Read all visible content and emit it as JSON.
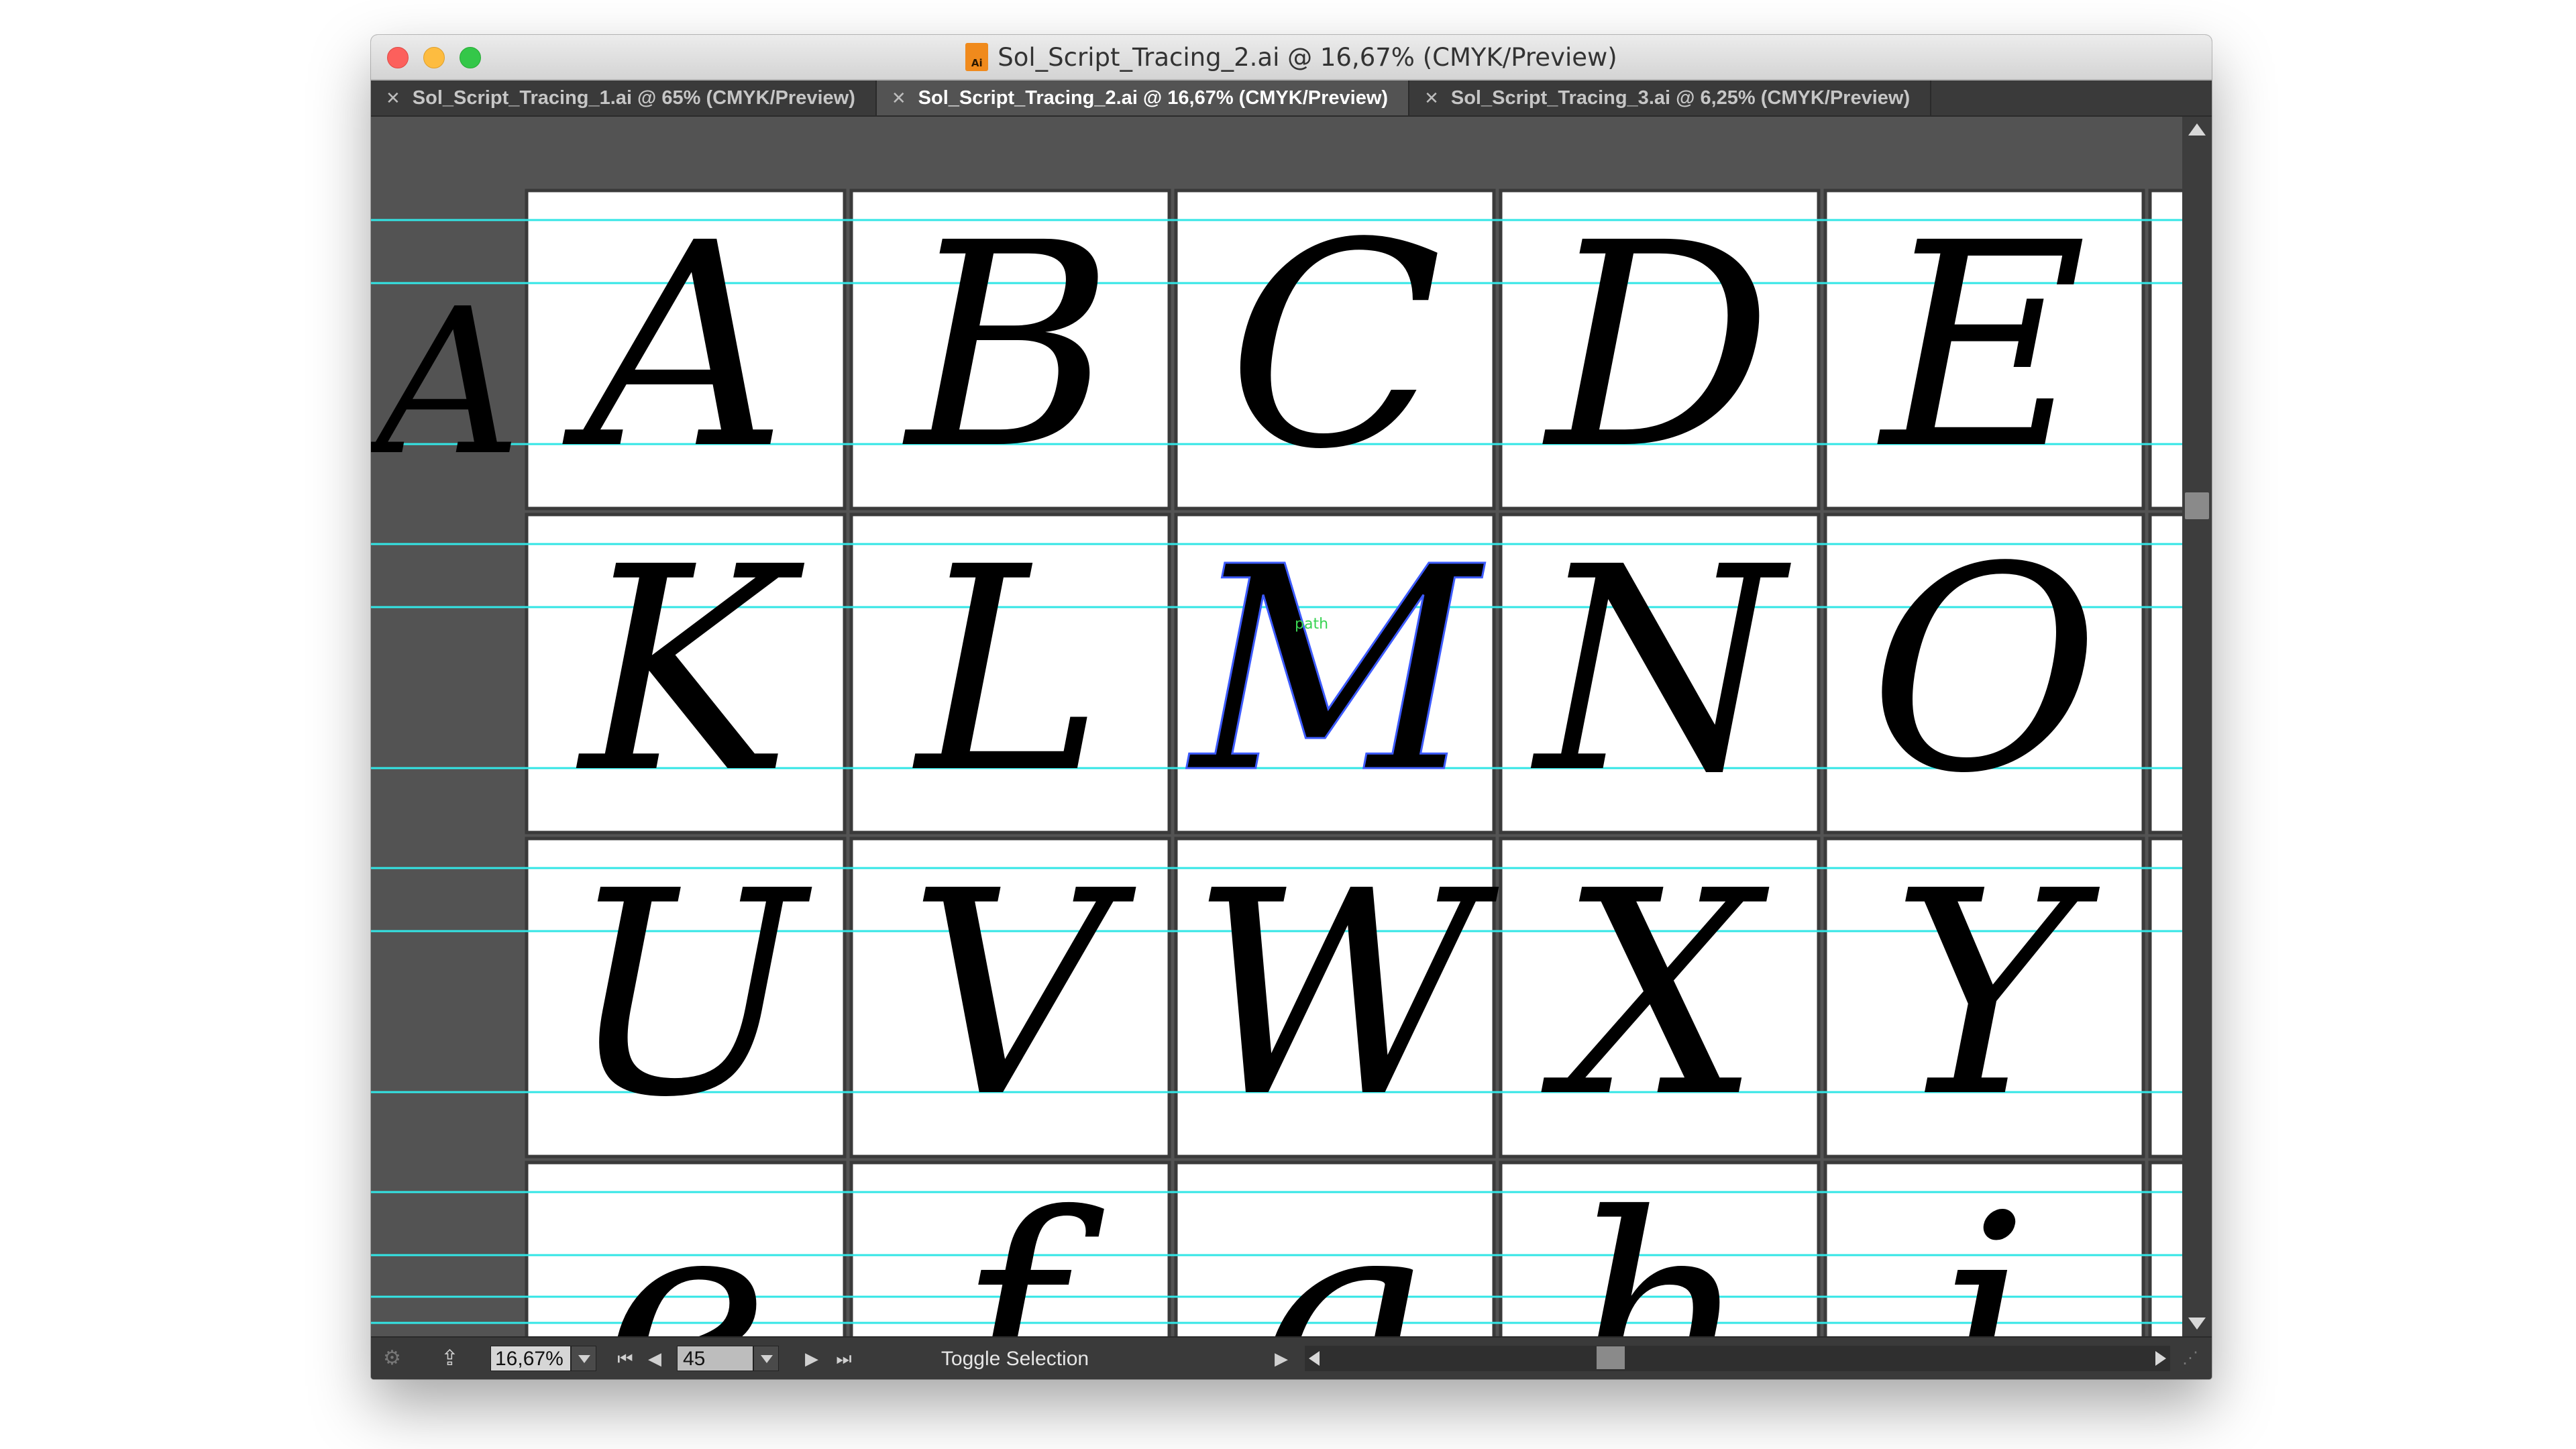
{
  "window": {
    "title": "Sol_Script_Tracing_2.ai @ 16,67% (CMYK/Preview)",
    "file_icon_text": "Ai"
  },
  "tabs": [
    {
      "label": "Sol_Script_Tracing_1.ai @ 65% (CMYK/Preview)",
      "active": false
    },
    {
      "label": "Sol_Script_Tracing_2.ai @ 16,67% (CMYK/Preview)",
      "active": true
    },
    {
      "label": "Sol_Script_Tracing_3.ai @ 6,25% (CMYK/Preview)",
      "active": false
    }
  ],
  "canvas": {
    "pasteboard_letter": "A",
    "rows": [
      [
        "A",
        "B",
        "C",
        "D",
        "E"
      ],
      [
        "K",
        "L",
        "M",
        "N",
        "O"
      ],
      [
        "U",
        "V",
        "W",
        "X",
        "Y"
      ],
      [
        "e",
        "f",
        "g",
        "h",
        "i"
      ]
    ],
    "selected_letter": "M",
    "path_hint": "path",
    "guide_color": "#33e6e6",
    "selection_color": "#3d5bff",
    "artboard_color": "#ffffff"
  },
  "statusbar": {
    "zoom": "16,67%",
    "artboard": "45",
    "status_text": "Toggle Selection",
    "first_symbol": "⏮",
    "prev_symbol": "◀",
    "next_symbol": "▶",
    "last_symbol": "⏭",
    "status_arrow": "▶"
  }
}
